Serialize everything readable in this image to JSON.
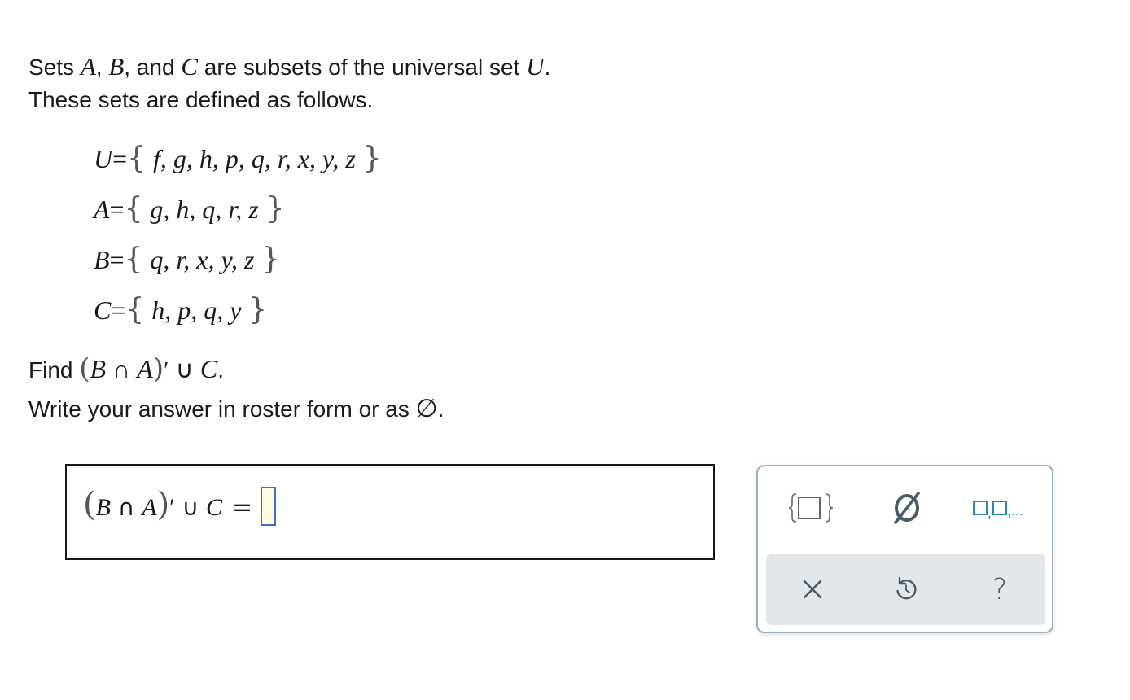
{
  "problem": {
    "intro_line1": {
      "t1": "Sets ",
      "a": "A",
      "t2": ", ",
      "b": "B",
      "t3": ", and ",
      "c": "C",
      "t4": " are subsets of the universal set ",
      "u": "U",
      "t5": "."
    },
    "intro_line2": "These sets are defined as follows.",
    "sets": [
      {
        "name": "U",
        "eq": "=",
        "open": "{",
        "elements": "f, g, h, p, q, r, x, y, z",
        "close": "}"
      },
      {
        "name": "A",
        "eq": "=",
        "open": "{",
        "elements": "g, h, q, r, z",
        "close": "}"
      },
      {
        "name": "B",
        "eq": "=",
        "open": "{",
        "elements": "q, r, x, y, z",
        "close": "}"
      },
      {
        "name": "C",
        "eq": "=",
        "open": "{",
        "elements": "h, p, q, y",
        "close": "}"
      }
    ],
    "find": {
      "label": "Find ",
      "open": "(",
      "b": "B",
      "cap": " ∩ ",
      "a": "A",
      "close": ")",
      "prime": "′",
      "cup": " ∪ ",
      "c": "C",
      "end": "."
    },
    "instruction": {
      "text": "Write your answer in roster form or as ",
      "symbol": "∅",
      "end": "."
    }
  },
  "answer": {
    "open": "(",
    "b": "B",
    "cap": " ∩ ",
    "a": "A",
    "close": ")",
    "prime": "′",
    "cup": " ∪ ",
    "c": "C",
    "eq": "=",
    "value": ""
  },
  "palette": {
    "buttons": [
      {
        "id": "set-braces",
        "icon": "set-braces-icon"
      },
      {
        "id": "empty-set",
        "icon": "empty-set-icon"
      },
      {
        "id": "list-slots",
        "icon": "list-slots-icon",
        "ellipsis": ",..."
      }
    ],
    "tools": [
      {
        "id": "clear",
        "icon": "close-icon"
      },
      {
        "id": "undo",
        "icon": "undo-icon"
      },
      {
        "id": "help",
        "icon": "help-icon",
        "glyph": "?"
      }
    ]
  },
  "colors": {
    "slot_border": "#3b6fd8",
    "slot_fill": "#fffce0",
    "palette_icon": "#2d86b8",
    "palette_border": "#9db0c0",
    "tool_strip": "#e3e7ea",
    "tool_icon": "#4a5a68"
  }
}
